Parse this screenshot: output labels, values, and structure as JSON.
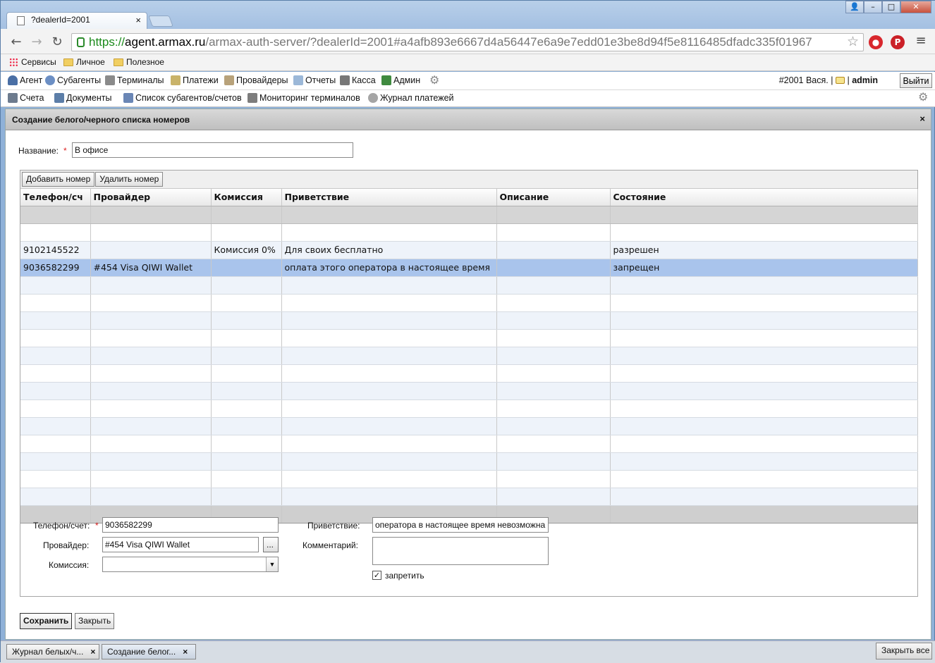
{
  "browser": {
    "tab_title": "?dealerId=2001",
    "tab_close": "×",
    "window_controls": [
      "👤",
      "–",
      "□",
      "✕"
    ],
    "url_scheme": "https://",
    "url_host": "agent.armax.ru",
    "url_rest": "/armax-auth-server/?dealerId=2001#a4afb893e6667d4a56447e6a9e7edd01e3be8d94f5e8116485dfadc335f01967",
    "bookmarks": [
      "Сервисы",
      "Личное",
      "Полезное"
    ]
  },
  "menu": {
    "items": [
      "Агент",
      "Субагенты",
      "Терминалы",
      "Платежи",
      "Провайдеры",
      "Отчеты",
      "Касса",
      "Админ"
    ],
    "user_dealer": "#2001 Вася.",
    "user_sep1": "|",
    "user_sep2": "|",
    "user_name": "admin",
    "logout": "Выйти"
  },
  "submenu": {
    "items": [
      "Счета",
      "Документы",
      "Список субагентов/счетов",
      "Мониторинг терминалов",
      "Журнал платежей"
    ]
  },
  "panel": {
    "title": "Создание белого/черного списка номеров",
    "close": "×",
    "name_label": "Название:",
    "name_value": "В офисе",
    "required_mark": "*"
  },
  "grid": {
    "add_button": "Добавить номер",
    "delete_button": "Удалить номер",
    "columns": [
      "Телефон/сч",
      "Провайдер",
      "Комиссия",
      "Приветствие",
      "Описание",
      "Состояние"
    ],
    "rows": [
      [
        "9102145522",
        "",
        "Комиссия 0%",
        "Для своих бесплатно",
        "",
        "разрешен"
      ],
      [
        "9036582299",
        "#454 Visa QIWI Wallet",
        "",
        "оплата этого оператора в настоящее время",
        "",
        "запрещен"
      ]
    ],
    "selected_row": 1
  },
  "form": {
    "phone_label": "Телефон/счет:",
    "phone_value": "9036582299",
    "provider_label": "Провайдер:",
    "provider_value": "#454 Visa QIWI Wallet",
    "provider_browse": "...",
    "commission_label": "Комиссия:",
    "commission_value": "",
    "greeting_label": "Приветствие:",
    "greeting_value": "оператора в настоящее время невозможна",
    "comment_label": "Комментарий:",
    "comment_value": "",
    "forbid_label": "запретить",
    "forbid_checked": true
  },
  "actions": {
    "save": "Сохранить",
    "close": "Закрыть"
  },
  "taskbar": {
    "tasks": [
      "Журнал белых/ч...",
      "Создание белог..."
    ],
    "task_close": "×",
    "close_all": "Закрыть все"
  }
}
